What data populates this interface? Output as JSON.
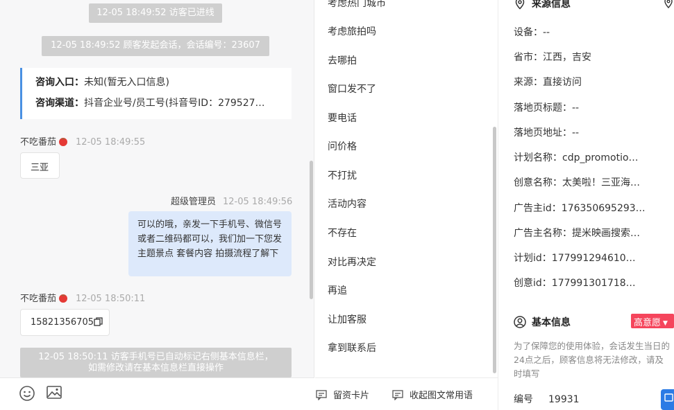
{
  "chat": {
    "top_cut_left": "",
    "top_cut_right": "",
    "sys_visitor_in": "12-05 18:49:52 访客已进线",
    "sys_session": "12-05 18:49:52 顾客发起会话，会话编号：23607",
    "entry_label": "咨询入口：",
    "entry_value": "未知(暂无入口信息)",
    "channel_label": "咨询渠道：",
    "channel_value": "抖音企业号/员工号(抖音号ID：279527…",
    "msg1_sender": "不吃番茄",
    "msg1_time": "12-05 18:49:55",
    "msg1_text": "三亚",
    "agent_sender": "超级管理员",
    "agent_time": "12-05 18:49:56",
    "agent_text": "可以的哦，亲发一下手机号、微信号或者二维码都可以，我们加一下您发主题景点 套餐内容 拍摄流程了解下",
    "msg2_sender": "不吃番茄",
    "msg2_time": "12-05 18:50:11",
    "msg2_text": "15821356705",
    "sys_phone_line1": "12-05 18:50:11 访客手机号已自动标记右侧基本信息栏，",
    "sys_phone_line2": "如需修改请在基本信息栏直接操作"
  },
  "toolbar": {
    "emoji_icon": "emoji-icon",
    "image_icon": "image-icon"
  },
  "phrases": {
    "items": [
      "考虑热门城市",
      "考虑旅拍吗",
      "去哪拍",
      "窗口发不了",
      "要电话",
      "问价格",
      "不打扰",
      "活动内容",
      "不存在",
      "对比再决定",
      "再追",
      "让加客服",
      "拿到联系后"
    ],
    "card_label": "留资卡片",
    "collapse_label": "收起图文常用语"
  },
  "info": {
    "source_title": "来源信息",
    "fields": [
      {
        "label": "设备：",
        "value": "--"
      },
      {
        "label": "省市：",
        "value": "江西，吉安"
      },
      {
        "label": "来源：",
        "value": "直接访问"
      },
      {
        "label": "落地页标题：",
        "value": "--"
      },
      {
        "label": "落地页地址：",
        "value": "--"
      },
      {
        "label": "计划名称：",
        "value": "cdp_promotio…"
      },
      {
        "label": "创意名称：",
        "value": "太美啦！三亚海…"
      },
      {
        "label": "广告主id：",
        "value": "176350695293…"
      },
      {
        "label": "广告主名称：",
        "value": "提米映画搜索…"
      },
      {
        "label": "计划id：",
        "value": "177991294610…"
      },
      {
        "label": "创意id：",
        "value": "177991301718…"
      }
    ],
    "basic_title": "基本信息",
    "intent_badge": "高意愿",
    "hint": "为了保障您的使用体验，会话发生当日的24点之后，顾客信息将无法修改，请及时填写",
    "id_label": "编号",
    "id_value": "19931"
  },
  "colors": {
    "accent": "#4a90e2",
    "agent_bubble": "#dde9fb",
    "system_msg": "#cfcfcf",
    "badge": "#f5455c"
  }
}
